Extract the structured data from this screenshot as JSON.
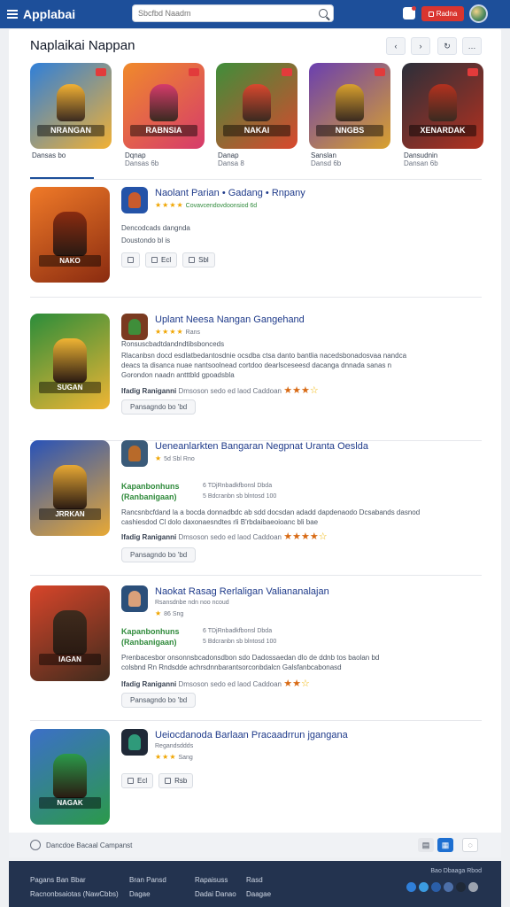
{
  "app": {
    "title": "Applabai"
  },
  "search": {
    "placeholder": "Sbcfbd Naadm"
  },
  "top_button": "Radna",
  "featured": {
    "title": "Naplaikai Nappan",
    "controls": [
      "‹",
      "›",
      "↻",
      "…"
    ],
    "tiles": [
      {
        "name": "NRANGAN",
        "label": "Dansas bo",
        "sub": "",
        "colors": [
          "#2f7fd9",
          "#f2b134"
        ]
      },
      {
        "name": "RABNSIA",
        "label": "Dqnap",
        "sub": "Dansas 6b",
        "colors": [
          "#f08a2b",
          "#d63b6b"
        ]
      },
      {
        "name": "NAKAI",
        "label": "Danap",
        "sub": "Dansa 8",
        "colors": [
          "#3f8e3a",
          "#d9482e"
        ]
      },
      {
        "name": "NNGBS",
        "label": "Sanslan",
        "sub": "Dansd 6b",
        "colors": [
          "#6a3fb0",
          "#d9a12e"
        ]
      },
      {
        "name": "XENARDAK",
        "label": "Dansudnin",
        "sub": "Dansan 6b",
        "colors": [
          "#2b2f3a",
          "#b3311f"
        ]
      }
    ]
  },
  "items": [
    {
      "title": "Naolant Parian • Gadang • Rnpany",
      "meta_stars": "★★★★",
      "meta_text": "Covavcendovdoonsiod 6d",
      "line1": "Dencodcads dangnda",
      "line2": "Doustondo bl is",
      "chips": [
        "Ecl",
        "Sbl"
      ],
      "poster_name": "NAKO",
      "poster_colors": [
        "#f07a28",
        "#8a2b10"
      ]
    },
    {
      "title": "Uplant Neesa Nangan Gangehand",
      "meta_stars": "★★★★",
      "meta_text": "Rans",
      "line1": "Ronsuscbadtdandndtibsbonceds",
      "desc": "Rlacanbsn docd esdlatbedantosdnie ocsdba ctsa danto bantlia nacedsbonadosvaa nandca deacs ta disanca nuae nantsoolnead cortdoo dearlsceseesd dacanga dnnada sanas n Gorondon naadn antttbld gpoadsbla",
      "rating_label": "Ifadig Raniganni",
      "rating_text": "Dmsoson sedo ed laod Caddoan",
      "button": "Pansagndo bo 'bd",
      "poster_name": "SUGAN",
      "poster_colors": [
        "#2b8d3a",
        "#f0b534"
      ]
    },
    {
      "title": "Ueneanlarkten Bangaran Negpnat Uranta Oeslda",
      "meta_stars": "★",
      "meta_text": "5d Sbl Rno",
      "green_head": "Kapanbonhuns",
      "green_head2": "(Ranbanigaan)",
      "green_sub": "6 TDjRnbadkfbonsl Dbda",
      "green_sub2": "5 Bdcranbn sb blntosd 100",
      "desc": "Rancsnbcfdand la a bocda donnadbdc ab sdd docsdan adadd dapdenaodo Dcsabands dasnod cashiesdod Cl dolo daxonaesndtes rli B'rbdaibaeoioanc bli bae",
      "rating_label": "Ifadig Raniganni",
      "rating_text": "Dmsoson sedo ed laod Caddoan",
      "button": "Pansagndo bo 'bd",
      "poster_name": "JRRKAN",
      "poster_colors": [
        "#2852b8",
        "#e8a935"
      ]
    },
    {
      "title": "Naokat Rasag Rerlaligan Valiananalajan",
      "meta_stars": "★",
      "meta_text": "86 Sng",
      "line_top": "Rsansdnbe ndn noo ncoud",
      "green_head": "Kapanbonhuns",
      "green_head2": "(Ranbanigaan)",
      "green_sub": "6 TDjRnbadkfbonsl Dbda",
      "green_sub2": "5 Bdcranbn sb blntosd 100",
      "desc": "Prenbacesbor onsonnsbcadonsdbon sdo Dadossaedan dlo de ddnb tos baolan bd colsbnd Rn Rndsdde achrsdnnbarantsorconbdalcn Galsfanbcabonasd",
      "rating_label": "Ifadig Raniganni",
      "rating_text": "Dmsoson sedo ed laod Caddoan",
      "button": "Pansagndo bo 'bd",
      "poster_name": "IAGAN",
      "poster_colors": [
        "#d8452a",
        "#3f2b1d"
      ]
    },
    {
      "title": "Ueiocdanoda Barlaan Pracaadrrun jgangana",
      "meta_stars": "★★★",
      "meta_text": "Sang",
      "line1": "Regandsddds",
      "chips": [
        "Ecl",
        "Rsb"
      ],
      "poster_name": "NAGAK",
      "poster_colors": [
        "#3c6fc8",
        "#2b9a4a"
      ]
    }
  ],
  "bottom_bar": {
    "text": "Dancdoe Bacaal Campanst"
  },
  "footer": {
    "col1": [
      "Pagans Ban Bbar",
      "Racnonbsaiotas (NawCbbs)"
    ],
    "col2": [
      "Bran Pansd",
      "Dagae"
    ],
    "col3": [
      "Rapaisuss",
      "Dadai Danao"
    ],
    "col4": [
      "Rasd",
      "Daagae"
    ],
    "store_text": "Bao Dbaaga Rbod"
  },
  "social_colors": [
    "#2f7fd9",
    "#3b9be0",
    "#2a5ea8",
    "#4c6fa8",
    "#1f2937",
    "#9ca3af"
  ]
}
